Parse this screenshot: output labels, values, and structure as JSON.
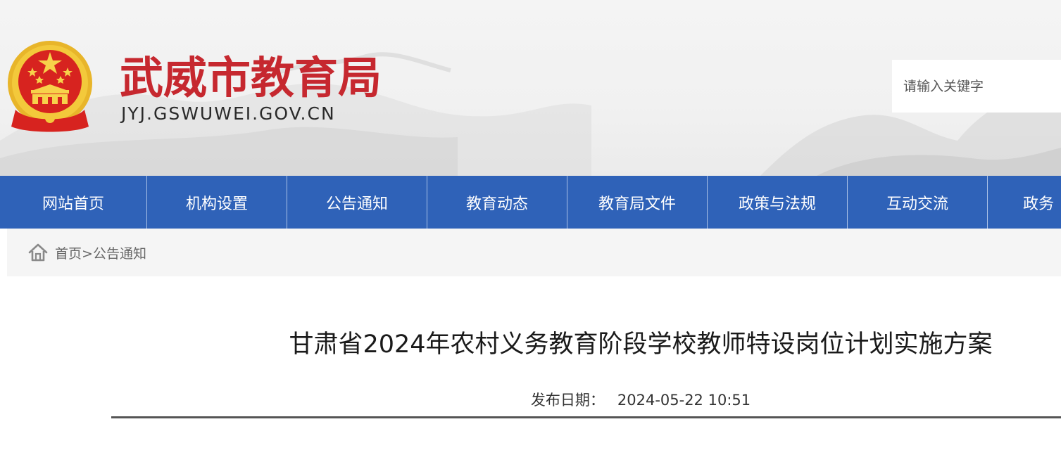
{
  "header": {
    "site_title": "武威市教育局",
    "site_domain": "JYJ.GSWUWEI.GOV.CN",
    "emblem_icon": "national-emblem-icon",
    "search": {
      "placeholder": "请输入关键字",
      "value": ""
    }
  },
  "nav": {
    "items": [
      {
        "label": "网站首页"
      },
      {
        "label": "机构设置"
      },
      {
        "label": "公告通知"
      },
      {
        "label": "教育动态"
      },
      {
        "label": "教育局文件"
      },
      {
        "label": "政策与法规"
      },
      {
        "label": "互动交流"
      },
      {
        "label": "政务"
      }
    ]
  },
  "breadcrumb": {
    "icon": "home-icon",
    "home": "首页",
    "separator": ">",
    "current": "公告通知"
  },
  "article": {
    "title": "甘肃省2024年农村义务教育阶段学校教师特设岗位计划实施方案",
    "publish_label": "发布日期：",
    "publish_datetime": "2024-05-22 10:51"
  },
  "colors": {
    "title_red": "#c6282f",
    "nav_blue": "#2f62b8",
    "breadcrumb_bg": "#f5f5f5"
  }
}
